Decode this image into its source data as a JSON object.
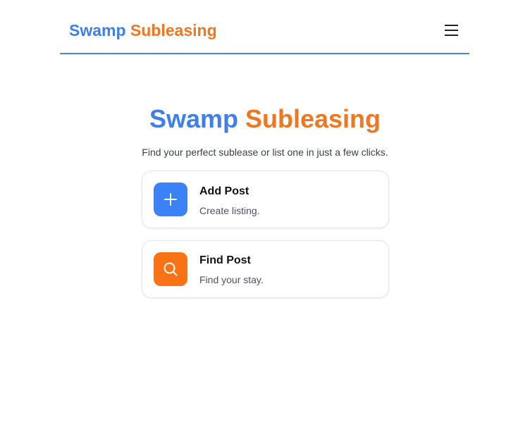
{
  "header": {
    "brand_part1": "Swamp",
    "brand_part2": "Subleasing",
    "menu_icon": "hamburger-menu-icon"
  },
  "hero": {
    "title_part1": "Swamp",
    "title_part2": "Subleasing",
    "subtitle": "Find your perfect sublease or list one in just a few clicks."
  },
  "cards": [
    {
      "title": "Add Post",
      "description": "Create listing.",
      "icon": "plus-icon",
      "color": "#3b82f6"
    },
    {
      "title": "Find Post",
      "description": "Find your stay.",
      "icon": "search-icon",
      "color": "#f97316"
    }
  ],
  "colors": {
    "brand_blue": "#3f7fe8",
    "brand_orange": "#f07722",
    "header_rule": "#4a86e8"
  }
}
